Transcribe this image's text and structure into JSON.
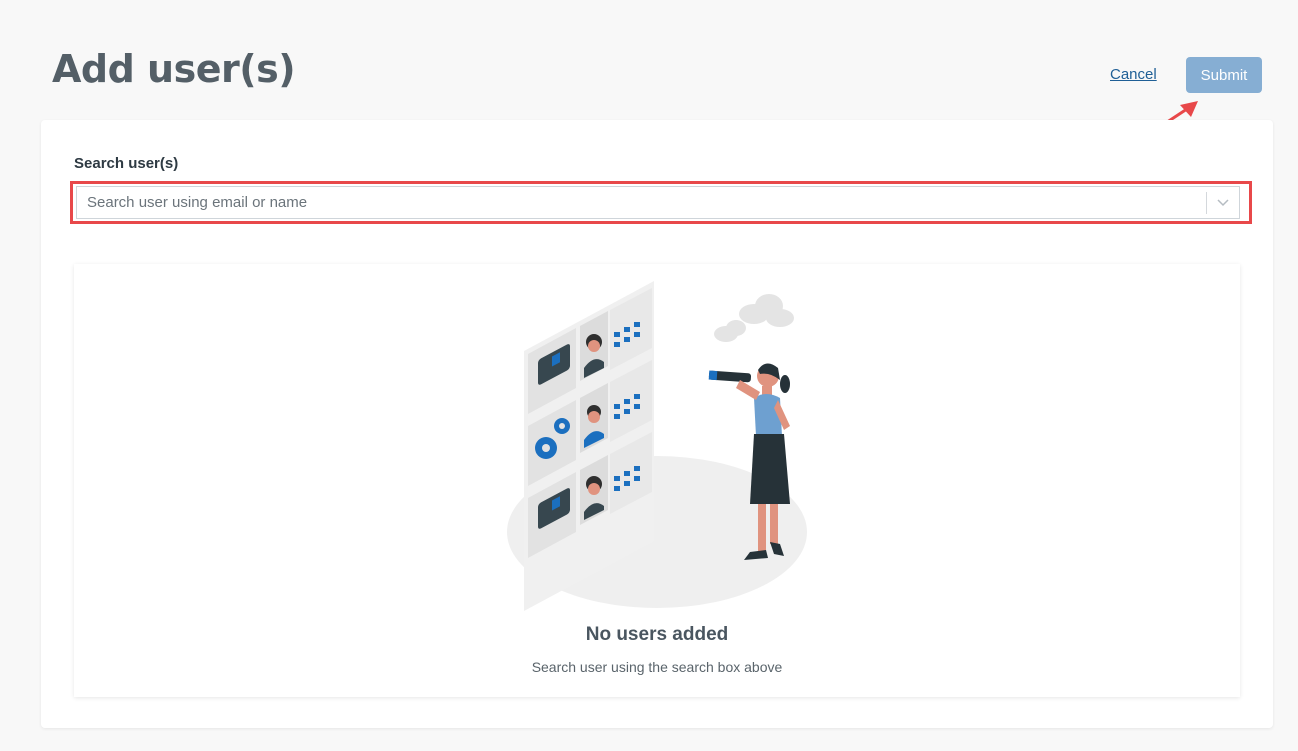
{
  "header": {
    "title": "Add user(s)",
    "cancel_label": "Cancel",
    "submit_label": "Submit",
    "submit_color": "#86aed3"
  },
  "search": {
    "label": "Search user(s)",
    "placeholder": "Search user using email or name",
    "value": "",
    "toggle_icon": "chevron-down-icon"
  },
  "empty_state": {
    "illustration": "woman-with-telescope-searching-candidate-profiles",
    "title": "No users added",
    "subtitle": "Search user using the search box above"
  },
  "colors": {
    "annotation": "#e8484a",
    "link": "#1f5f96",
    "accent_blue": "#1b6fbf"
  }
}
